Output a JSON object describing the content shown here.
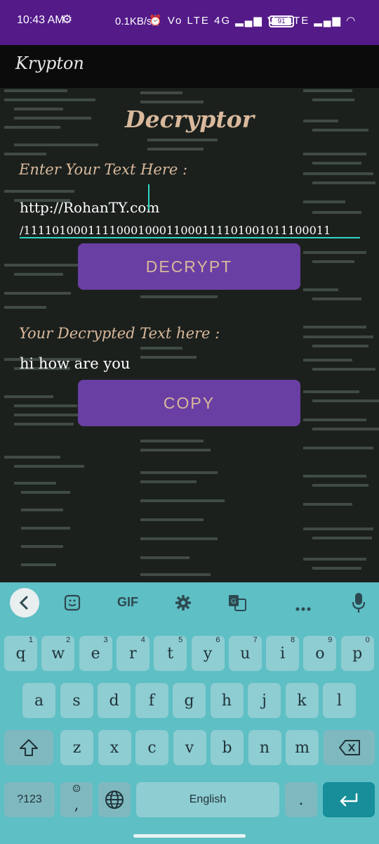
{
  "status": {
    "time": "10:43 AM",
    "speed": "0.1KB/s",
    "icons": "⏰ Vo LTE 4G ▂▄▆ Vo LTE ▂▄▆ ◠",
    "battery": "91"
  },
  "app": {
    "title": "Krypton"
  },
  "screen": {
    "heading": "Decryptor",
    "input_label": "Enter Your Text Here :",
    "input_value_line1": "http://RohanTY.com",
    "input_value_line2": "/1111010001111000100011000111101001011100011",
    "decrypt_label": "DECRYPT",
    "output_label": "Your Decrypted Text here :",
    "output_value": "hi how are you",
    "copy_label": "COPY"
  },
  "keyboard": {
    "toolbar": {
      "gif": "GIF"
    },
    "row1": [
      {
        "k": "q",
        "h": "1"
      },
      {
        "k": "w",
        "h": "2"
      },
      {
        "k": "e",
        "h": "3"
      },
      {
        "k": "r",
        "h": "4"
      },
      {
        "k": "t",
        "h": "5"
      },
      {
        "k": "y",
        "h": "6"
      },
      {
        "k": "u",
        "h": "7"
      },
      {
        "k": "i",
        "h": "8"
      },
      {
        "k": "o",
        "h": "9"
      },
      {
        "k": "p",
        "h": "0"
      }
    ],
    "row2": [
      "a",
      "s",
      "d",
      "f",
      "g",
      "h",
      "j",
      "k",
      "l"
    ],
    "row3": [
      "z",
      "x",
      "c",
      "v",
      "b",
      "n",
      "m"
    ],
    "symbols_label": "?123",
    "comma_label": ",",
    "space_label": "English",
    "period_label": "."
  },
  "colors": {
    "status_bar": "#531a88",
    "accent_text": "#d9b99c",
    "button": "#6a3fa3",
    "cursor": "#2dd6c6",
    "keyboard_bg": "#5ebfc4",
    "key_bg": "#8ecdd2",
    "enter_key": "#178e99"
  }
}
